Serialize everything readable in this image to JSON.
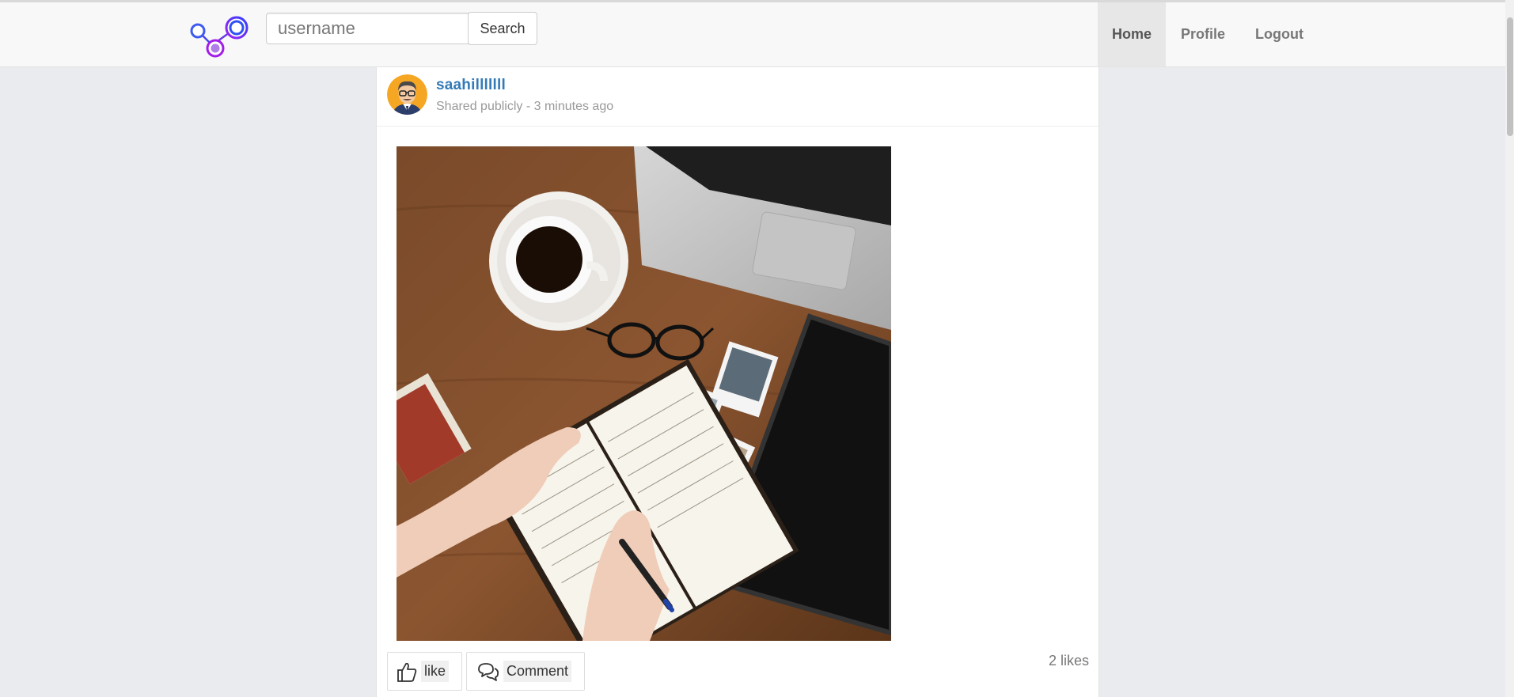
{
  "search": {
    "placeholder": "username",
    "button_label": "Search"
  },
  "nav": {
    "items": [
      {
        "label": "Home",
        "active": true
      },
      {
        "label": "Profile",
        "active": false
      },
      {
        "label": "Logout",
        "active": false
      }
    ]
  },
  "post": {
    "author": "saahilllllll",
    "meta": "Shared publicly - 3 minutes ago",
    "like_label": "like",
    "comment_label": "Comment",
    "likes": "2 likes"
  },
  "colors": {
    "accent": "#337ab7",
    "nav_active_bg": "#e7e7e7",
    "page_bg": "#e9ebee"
  }
}
